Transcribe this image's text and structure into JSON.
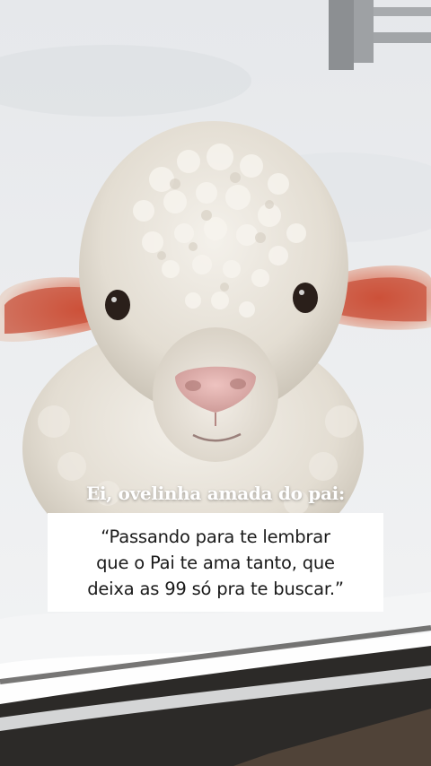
{
  "caption": {
    "heading": "Ei, ovelinha amada do pai:",
    "quote_line_1": "“Passando para te lembrar",
    "quote_line_2": "que o Pai te ama tanto, que",
    "quote_line_3": "deixa as 99 só pra te buscar.”"
  },
  "colors": {
    "caption_text": "#ffffff",
    "quote_box_background": "#ffffff",
    "quote_text": "#1a1a1a",
    "snow": "#f1f2f4",
    "fleece": "#e8e3da",
    "ear_inner": "#c9503a",
    "nose": "#e2b3b0",
    "window_frame": "#2c2a28"
  }
}
